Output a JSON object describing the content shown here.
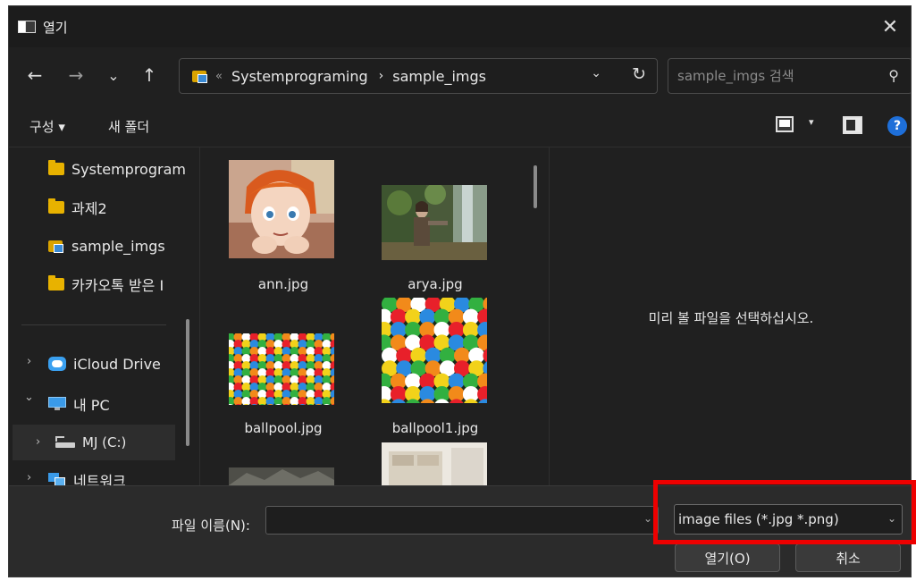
{
  "window": {
    "title": "열기",
    "close_glyph": "✕"
  },
  "nav": {
    "back_glyph": "←",
    "forward_glyph": "→",
    "recent_glyph": "⌄",
    "up_glyph": "↑",
    "overflow_glyph": "«",
    "breadcrumbs": [
      "Systemprograming",
      "sample_imgs"
    ],
    "crumb_separator": "›",
    "dropdown_glyph": "⌄",
    "refresh_glyph": "↻"
  },
  "search": {
    "placeholder": "sample_imgs 검색",
    "icon": "search-icon",
    "glyph": "⚲"
  },
  "toolbar": {
    "organize_label": "구성 ▾",
    "new_folder_label": "새 폴더",
    "view_caret": "▾",
    "help_glyph": "?"
  },
  "sidebar": {
    "chevron_right": "›",
    "chevron_down": "⌄",
    "items": [
      {
        "label": "Systemprogram",
        "icon": "folder-icon"
      },
      {
        "label": "과제2",
        "icon": "folder-icon"
      },
      {
        "label": "sample_imgs",
        "icon": "image-folder-icon"
      },
      {
        "label": "카카오톡 받은 I",
        "icon": "folder-icon"
      },
      {
        "label": "iCloud Drive",
        "icon": "icloud-icon"
      },
      {
        "label": "내 PC",
        "icon": "pc-icon"
      },
      {
        "label": "MJ (C:)",
        "icon": "drive-icon"
      },
      {
        "label": "네트워크",
        "icon": "network-icon"
      }
    ]
  },
  "files": [
    {
      "name": "ann.jpg"
    },
    {
      "name": "arya.jpg"
    },
    {
      "name": "ballpool.jpg"
    },
    {
      "name": "ballpool1.jpg"
    }
  ],
  "preview": {
    "message": "미리 볼 파일을 선택하십시오."
  },
  "bottom": {
    "filename_label": "파일 이름(N):",
    "filename_value": "",
    "filter_value": "image files (*.jpg *.png)",
    "dropdown_glyph": "⌄",
    "open_label": "열기(O)",
    "cancel_label": "취소"
  },
  "colors": {
    "background": "#202020",
    "highlight": "#ee0000",
    "accent": "#1e6fd9",
    "folder": "#e8b200"
  }
}
